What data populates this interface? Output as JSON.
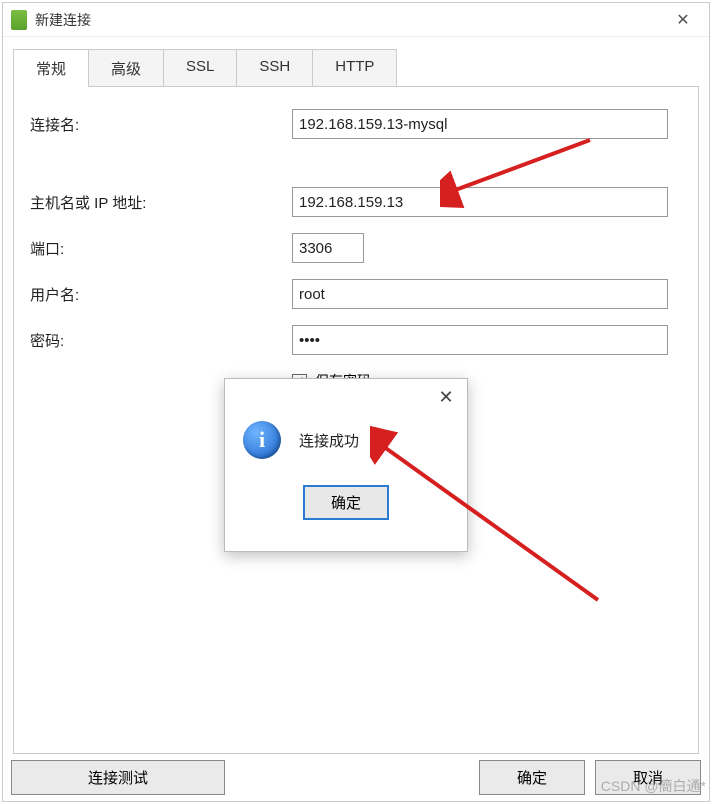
{
  "window": {
    "title": "新建连接"
  },
  "tabs": {
    "items": [
      {
        "label": "常规",
        "active": true
      },
      {
        "label": "高级",
        "active": false
      },
      {
        "label": "SSL",
        "active": false
      },
      {
        "label": "SSH",
        "active": false
      },
      {
        "label": "HTTP",
        "active": false
      }
    ]
  },
  "form": {
    "conn_name_label": "连接名:",
    "conn_name_value": "192.168.159.13-mysql",
    "host_label": "主机名或 IP 地址:",
    "host_value": "192.168.159.13",
    "port_label": "端口:",
    "port_value": "3306",
    "user_label": "用户名:",
    "user_value": "root",
    "pass_label": "密码:",
    "pass_value": "••••",
    "save_pass_label": "保存密码",
    "save_pass_checked": "✓"
  },
  "modal": {
    "message": "连接成功",
    "ok_label": "确定"
  },
  "footer": {
    "test_label": "连接测试",
    "ok_label": "确定",
    "cancel_label": "取消"
  },
  "watermark": "CSDN @簡白通*"
}
